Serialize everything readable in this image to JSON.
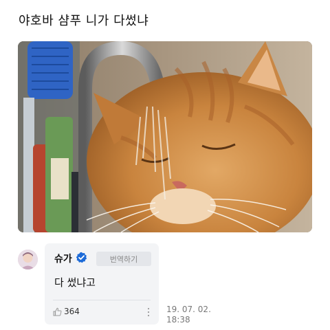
{
  "post": {
    "title": "야호바 샴푸 니가 다썼냐"
  },
  "comment": {
    "author": "슈가",
    "verified_color": "#1d6bd8",
    "translate_label": "번역하기",
    "text": "다 썼냐고",
    "likes": "364",
    "date": "19. 07. 02.",
    "time": "18:38"
  },
  "icons": {
    "verified": "verified-badge-icon",
    "like": "thumbs-up-icon",
    "more": "more-vertical-icon"
  }
}
